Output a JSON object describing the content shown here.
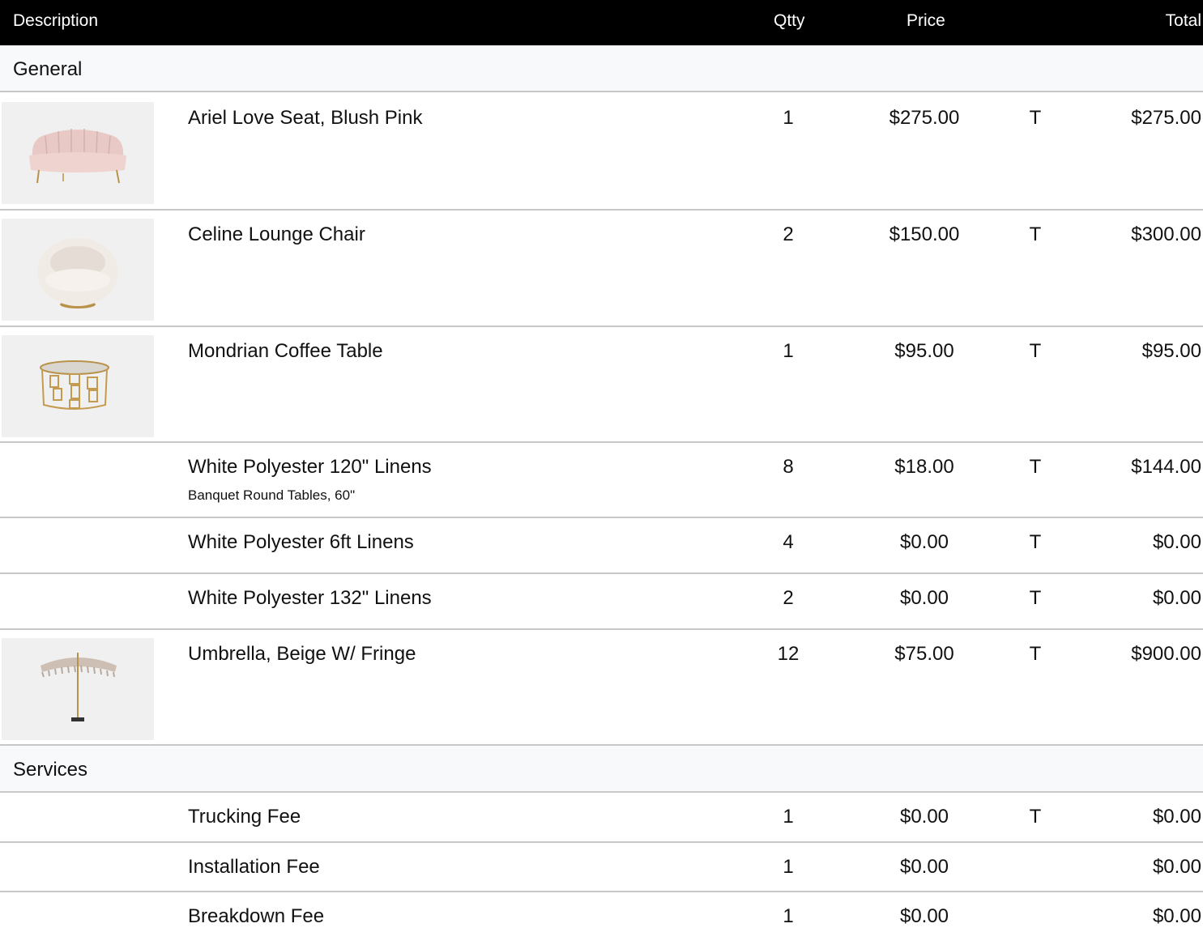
{
  "header": {
    "description": "Description",
    "qty": "Qtty",
    "price": "Price",
    "total": "Total"
  },
  "sections": [
    {
      "title": "General",
      "items": [
        {
          "name": "Ariel Love Seat, Blush Pink",
          "qty": "1",
          "price": "$275.00",
          "tax": "T",
          "total": "$275.00",
          "image": "love-seat"
        },
        {
          "name": "Celine Lounge Chair",
          "qty": "2",
          "price": "$150.00",
          "tax": "T",
          "total": "$300.00",
          "image": "lounge-chair"
        },
        {
          "name": "Mondrian Coffee Table",
          "qty": "1",
          "price": "$95.00",
          "tax": "T",
          "total": "$95.00",
          "image": "coffee-table"
        },
        {
          "name": "White Polyester 120\" Linens",
          "note": "Banquet Round Tables, 60\"",
          "qty": "8",
          "price": "$18.00",
          "tax": "T",
          "total": "$144.00"
        },
        {
          "name": "White Polyester 6ft Linens",
          "qty": "4",
          "price": "$0.00",
          "tax": "T",
          "total": "$0.00"
        },
        {
          "name": "White Polyester 132\" Linens",
          "qty": "2",
          "price": "$0.00",
          "tax": "T",
          "total": "$0.00"
        },
        {
          "name": "Umbrella, Beige W/ Fringe",
          "qty": "12",
          "price": "$75.00",
          "tax": "T",
          "total": "$900.00",
          "image": "umbrella"
        }
      ]
    },
    {
      "title": "Services",
      "items": [
        {
          "name": "Trucking Fee",
          "qty": "1",
          "price": "$0.00",
          "tax": "T",
          "total": "$0.00"
        },
        {
          "name": "Installation Fee",
          "qty": "1",
          "price": "$0.00",
          "tax": "",
          "total": "$0.00"
        },
        {
          "name": "Breakdown Fee",
          "qty": "1",
          "price": "$0.00",
          "tax": "",
          "total": "$0.00"
        }
      ]
    }
  ]
}
